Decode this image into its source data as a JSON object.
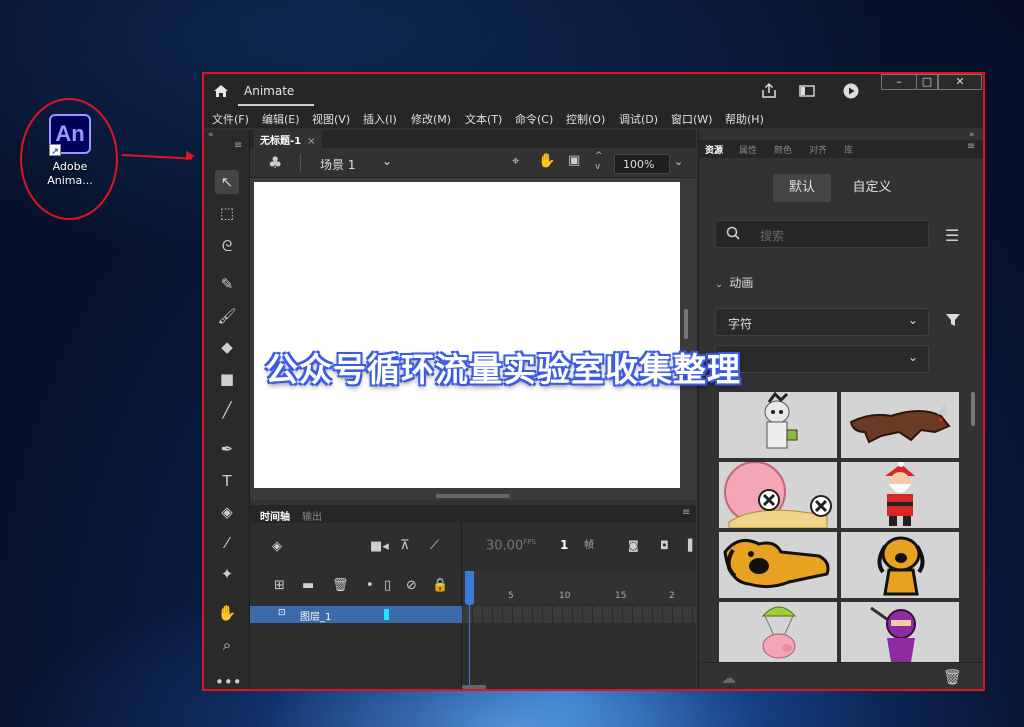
{
  "desktop": {
    "icon_label_line1": "Adobe",
    "icon_label_line2": "Anima...",
    "logo_text": "An"
  },
  "window": {
    "title": "Animate",
    "menu": [
      "文件(F)",
      "编辑(E)",
      "视图(V)",
      "插入(I)",
      "修改(M)",
      "文本(T)",
      "命令(C)",
      "控制(O)",
      "调试(D)",
      "窗口(W)",
      "帮助(H)"
    ]
  },
  "document": {
    "tab_title": "无标题-1",
    "tab_close": "×",
    "scene_label": "场景 1",
    "zoom": "100%"
  },
  "timeline": {
    "tabs": [
      "时间轴",
      "输出"
    ],
    "fps_value": "30.00",
    "fps_unit": "FPS",
    "current_frame": "1",
    "frame_unit": "帧",
    "ruler_ticks": [
      "5",
      "10",
      "15",
      "2"
    ],
    "layer_name": "图层_1"
  },
  "right_panel": {
    "tabs": [
      "资源",
      "属性",
      "颜色",
      "对齐",
      "库"
    ],
    "segment_default": "默认",
    "segment_custom": "自定义",
    "search_placeholder": "搜索",
    "section_title": "动画",
    "dropdown1": "字符",
    "dropdown2": "",
    "thumbnails": [
      "mummy",
      "werewolf",
      "snail",
      "santa",
      "dog-lying",
      "dog-sitting",
      "pig-parachute",
      "ninja"
    ]
  },
  "watermark": "公众号循环流量实验室收集整理",
  "colors": {
    "annotation_red": "#e0141e",
    "accent_blue": "#3a7bd5",
    "layer_highlight": "#3d6aa8"
  }
}
